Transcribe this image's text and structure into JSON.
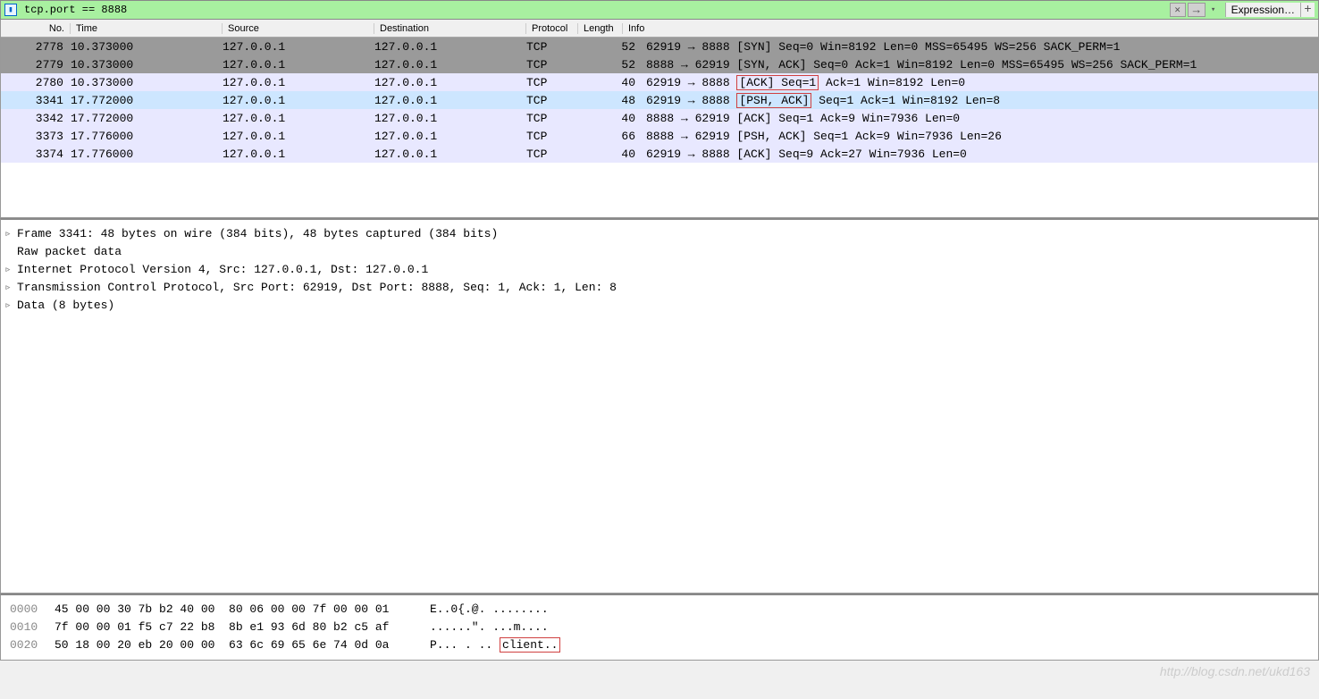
{
  "filter": {
    "value": "tcp.port == 8888",
    "expression_label": "Expression…"
  },
  "columns": {
    "no": "No.",
    "time": "Time",
    "src": "Source",
    "dst": "Destination",
    "proto": "Protocol",
    "len": "Length",
    "info": "Info"
  },
  "packets": [
    {
      "no": "2778",
      "time": "10.373000",
      "src": "127.0.0.1",
      "dst": "127.0.0.1",
      "proto": "TCP",
      "len": "52",
      "info": "62919 → 8888 [SYN] Seq=0 Win=8192 Len=0 MSS=65495 WS=256 SACK_PERM=1",
      "style": "dark"
    },
    {
      "no": "2779",
      "time": "10.373000",
      "src": "127.0.0.1",
      "dst": "127.0.0.1",
      "proto": "TCP",
      "len": "52",
      "info": "8888 → 62919 [SYN, ACK] Seq=0 Ack=1 Win=8192 Len=0 MSS=65495 WS=256 SACK_PERM=1",
      "style": "dark"
    },
    {
      "no": "2780",
      "time": "10.373000",
      "src": "127.0.0.1",
      "dst": "127.0.0.1",
      "proto": "TCP",
      "len": "40",
      "info_pre": "62919 → 8888 ",
      "info_hl": "[ACK] Seq=1",
      "info_post": " Ack=1 Win=8192 Len=0",
      "style": "light"
    },
    {
      "no": "3341",
      "time": "17.772000",
      "src": "127.0.0.1",
      "dst": "127.0.0.1",
      "proto": "TCP",
      "len": "48",
      "info_pre": "62919 → 8888 ",
      "info_hl": "[PSH, ACK]",
      "info_post": " Seq=1 Ack=1 Win=8192 Len=8",
      "style": "sel"
    },
    {
      "no": "3342",
      "time": "17.772000",
      "src": "127.0.0.1",
      "dst": "127.0.0.1",
      "proto": "TCP",
      "len": "40",
      "info": "8888 → 62919 [ACK] Seq=1 Ack=9 Win=7936 Len=0",
      "style": "light"
    },
    {
      "no": "3373",
      "time": "17.776000",
      "src": "127.0.0.1",
      "dst": "127.0.0.1",
      "proto": "TCP",
      "len": "66",
      "info": "8888 → 62919 [PSH, ACK] Seq=1 Ack=9 Win=7936 Len=26",
      "style": "light"
    },
    {
      "no": "3374",
      "time": "17.776000",
      "src": "127.0.0.1",
      "dst": "127.0.0.1",
      "proto": "TCP",
      "len": "40",
      "info": "62919 → 8888 [ACK] Seq=9 Ack=27 Win=7936 Len=0",
      "style": "light"
    }
  ],
  "details": {
    "frame": "Frame 3341: 48 bytes on wire (384 bits), 48 bytes captured (384 bits)",
    "raw": "Raw packet data",
    "ip": "Internet Protocol Version 4, Src: 127.0.0.1, Dst: 127.0.0.1",
    "tcp": "Transmission Control Protocol, Src Port: 62919, Dst Port: 8888, Seq: 1, Ack: 1, Len: 8",
    "data": "Data (8 bytes)"
  },
  "hex": [
    {
      "off": "0000",
      "bytes": "45 00 00 30 7b b2 40 00  80 06 00 00 7f 00 00 01",
      "ascii": "E..0{.@. ........"
    },
    {
      "off": "0010",
      "bytes": "7f 00 00 01 f5 c7 22 b8  8b e1 93 6d 80 b2 c5 af",
      "ascii": "......\". ...m...."
    },
    {
      "off": "0020",
      "bytes": "50 18 00 20 eb 20 00 00  63 6c 69 65 6e 74 0d 0a",
      "ascii_pre": "P... . .. ",
      "ascii_hl": "client.."
    }
  ],
  "watermark": "http://blog.csdn.net/ukd163"
}
